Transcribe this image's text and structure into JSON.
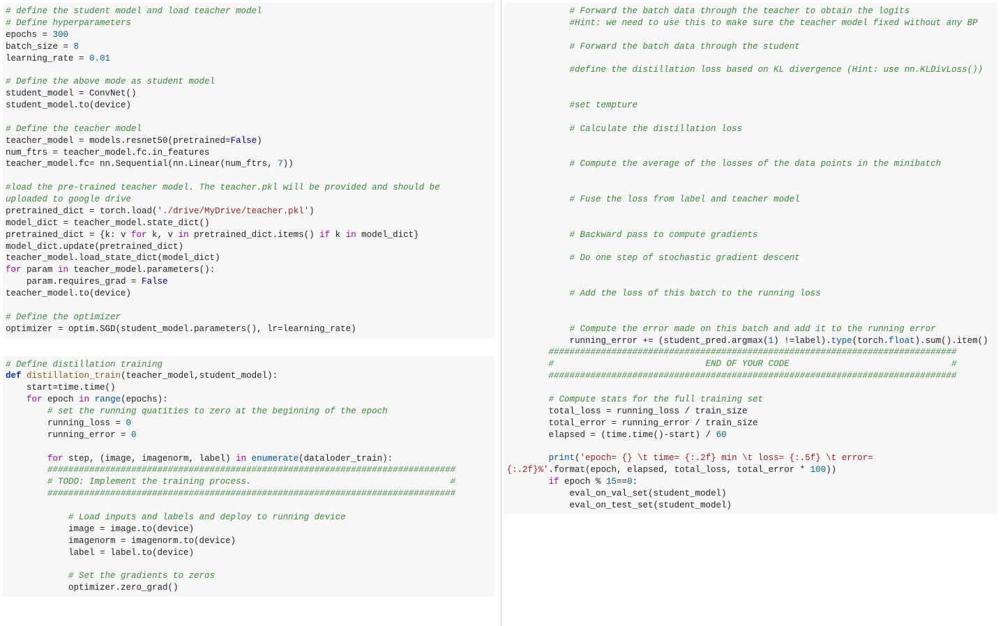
{
  "left": {
    "cell1": {
      "c1": "# define the student model and load teacher model",
      "c2": "# Define hyperparameters",
      "l1a": "epochs = ",
      "l1b": "300",
      "l2a": "batch_size = ",
      "l2b": "8",
      "l3a": "learning_rate = ",
      "l3b": "0.01",
      "c3": "# Define the above mode as student model",
      "l4": "student_model = ConvNet()",
      "l5": "student_model.to(device)",
      "c4": "# Define the teacher model",
      "l6a": "teacher_model = models.resnet50(pretrained=",
      "l6b": "False",
      "l6c": ")",
      "l7": "num_ftrs = teacher_model.fc.in_features",
      "l8a": "teacher_model.fc= nn.Sequential(nn.Linear(num_ftrs, ",
      "l8b": "7",
      "l8c": "))",
      "c5a": "#load the pre-trained teacher model. The teacher.pkl will be provided and should be",
      "c5b": "uploaded to google drive",
      "l9a": "pretrained_dict = torch.load(",
      "l9b": "'./drive/MyDrive/teacher.pkl'",
      "l9c": ")",
      "l10": "model_dict = teacher_model.state_dict()",
      "l11a": "pretrained_dict = {k: v ",
      "l11for": "for",
      "l11b": " k, v ",
      "l11in": "in",
      "l11c": " pretrained_dict.items() ",
      "l11if": "if",
      "l11d": " k ",
      "l11in2": "in",
      "l11e": " model_dict}",
      "l12": "model_dict.update(pretrained_dict)",
      "l13": "teacher_model.load_state_dict(model_dict)",
      "l14for": "for",
      "l14a": " param ",
      "l14in": "in",
      "l14b": " teacher_model.parameters():",
      "l15a": "    param.requires_grad = ",
      "l15b": "False",
      "l16": "teacher_model.to(device)",
      "c6": "# Define the optimizer",
      "l17": "optimizer = optim.SGD(student_model.parameters(), lr=learning_rate)"
    },
    "cell2": {
      "c1": "# Define distillation training",
      "l1def": "def",
      "l1sp": " ",
      "l1fn": "distillation_train",
      "l1p": "(teacher_model,student_model):",
      "l2": "    start=time.time()",
      "l3for": "    for",
      "l3a": " epoch ",
      "l3in": "in",
      "l3sp": " ",
      "l3rng": "range",
      "l3b": "(epochs):",
      "c2": "        # set the running quatities to zero at the beginning of the epoch",
      "l4a": "        running_loss = ",
      "l4b": "0",
      "l5a": "        running_error = ",
      "l5b": "0",
      "l6for": "        for",
      "l6a": " step, (image, imagenorm, label) ",
      "l6in": "in",
      "l6sp": " ",
      "l6enum": "enumerate",
      "l6b": "(dataloder_train):",
      "c3": "        ##############################################################################",
      "c4": "        # TODO: Implement the training process.                                      #",
      "c5": "        ##############################################################################",
      "c6": "            # Load inputs and labels and deploy to running device",
      "l7": "            image = image.to(device)",
      "l8": "            imagenorm = imagenorm.to(device)",
      "l9": "            label = label.to(device)",
      "c7": "            # Set the gradients to zeros",
      "l10": "            optimizer.zero_grad()"
    }
  },
  "right": {
    "cell1": {
      "c1": "            # Forward the batch data through the teacher to obtain the logits",
      "c2": "            #Hint: we need to use this to make sure the teacher model fixed without any BP",
      "c3": "            # Forward the batch data through the student",
      "c4": "            #define the distillation loss based on KL divergence (Hint: use nn.KLDivLoss())",
      "c5": "            #set tempture",
      "c6": "            # Calculate the distillation loss",
      "c7": "            # Compute the average of the losses of the data points in the minibatch",
      "c8": "            # Fuse the loss from label and teacher model",
      "c9": "            # Backward pass to compute gradients",
      "c10": "            # Do one step of stochastic gradient descent",
      "c11": "            # Add the loss of this batch to the running loss",
      "c12": "            # Compute the error made on this batch and add it to the running error",
      "l1a": "            running_error += (student_pred.argmax(",
      "l1b": "1",
      "l1c": ") !=label).",
      "l1ty": "type",
      "l1d": "(torch.",
      "l1fl": "float",
      "l1e": ").sum().item()",
      "c13": "        ##############################################################################",
      "c14": "        #                             END OF YOUR CODE                               #",
      "c15": "        ##############################################################################",
      "c16": "        # Compute stats for the full training set",
      "l2": "        total_loss = running_loss / train_size",
      "l3": "        total_error = running_error / train_size",
      "l4a": "        elapsed = (time.time()-start) / ",
      "l4b": "60",
      "l5a": "        print",
      "l5b": "(",
      "l5s1": "'epoch= {} \\t time= {:.2f} min \\t loss= {:.5f} \\t error=",
      "l5s2": "{:.2f}%'",
      "l5c": ".format(epoch, elapsed, total_loss, total_error * ",
      "l5d": "100",
      "l5e": "))",
      "l6if": "        if",
      "l6a": " epoch % ",
      "l6b": "15",
      "l6c": "==",
      "l6d": "0",
      "l6e": ":",
      "l7": "            eval_on_val_set(student_model)",
      "l8": "            eval_on_test_set(student_model)"
    }
  }
}
